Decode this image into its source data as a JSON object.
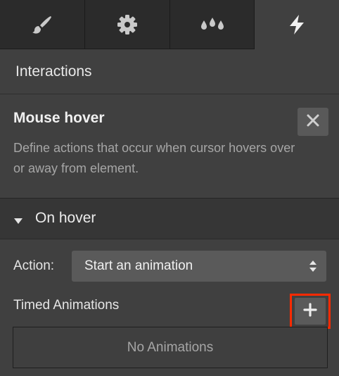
{
  "tabs": [
    {
      "icon": "brush-icon",
      "active": false
    },
    {
      "icon": "gear-icon",
      "active": false
    },
    {
      "icon": "drops-icon",
      "active": false
    },
    {
      "icon": "lightning-icon",
      "active": true
    }
  ],
  "panel": {
    "title": "Interactions"
  },
  "trigger": {
    "title": "Mouse hover",
    "description": "Define actions that occur when cursor hovers over or away from element.",
    "close_icon": "close-icon"
  },
  "on_hover": {
    "label": "On hover",
    "expanded": true
  },
  "action": {
    "label": "Action:",
    "value": "Start an animation"
  },
  "timed": {
    "label": "Timed Animations",
    "add_icon": "plus-icon",
    "empty_text": "No Animations"
  },
  "colors": {
    "highlight": "#ff2a00",
    "panel_bg": "#404040",
    "tabbar_bg": "#2b2b2b"
  }
}
